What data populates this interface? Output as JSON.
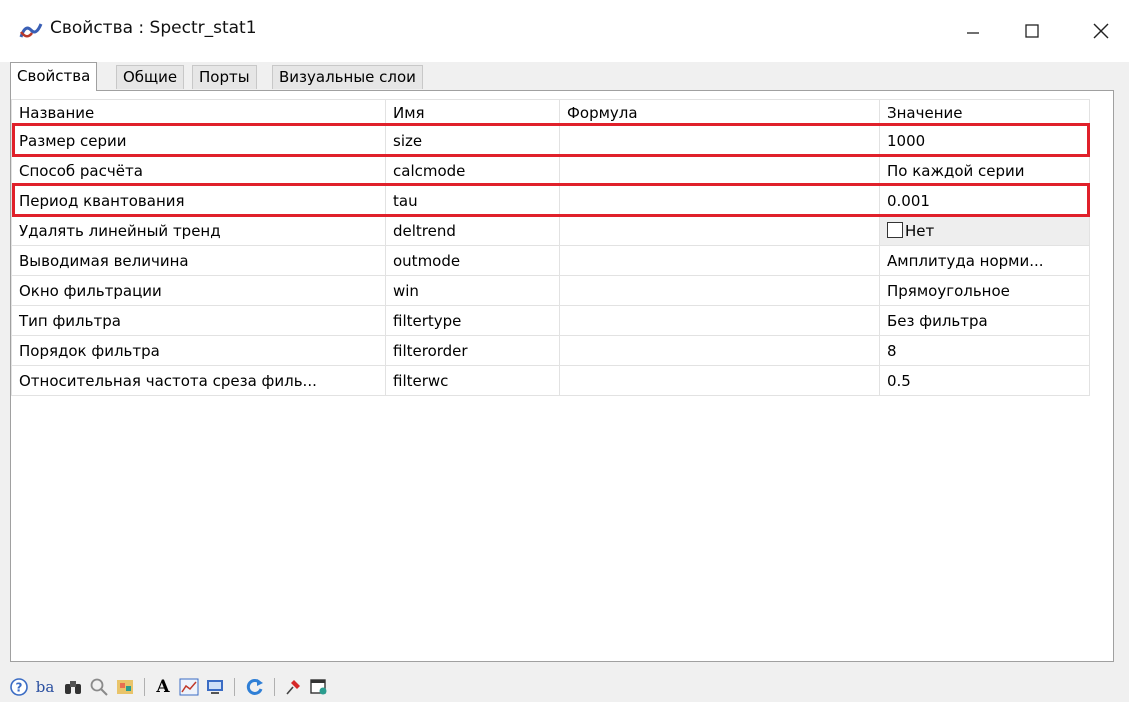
{
  "window": {
    "title": "Свойства : Spectr_stat1"
  },
  "tabs": [
    {
      "label": "Свойства",
      "active": true
    },
    {
      "label": "Общие",
      "active": false
    },
    {
      "label": "Порты",
      "active": false
    },
    {
      "label": "Визуальные слои",
      "active": false
    }
  ],
  "table": {
    "headers": [
      "Название",
      "Имя",
      "Формула",
      "Значение"
    ],
    "rows": [
      {
        "name": "Размер серии",
        "id": "size",
        "formula": "",
        "value": "1000",
        "highlighted": true
      },
      {
        "name": "Способ расчёта",
        "id": "calcmode",
        "formula": "",
        "value": "По каждой серии",
        "highlighted": false
      },
      {
        "name": "Период квантования",
        "id": "tau",
        "formula": "",
        "value": "0.001",
        "highlighted": true
      },
      {
        "name": "Удалять линейный тренд",
        "id": "deltrend",
        "formula": "",
        "value": "Нет",
        "checkbox": true,
        "checked": false,
        "highlighted": false
      },
      {
        "name": "Выводимая величина",
        "id": "outmode",
        "formula": "",
        "value": "Амплитуда норми...",
        "highlighted": false
      },
      {
        "name": "Окно фильтрации",
        "id": "win",
        "formula": "",
        "value": "Прямоугольное",
        "highlighted": false
      },
      {
        "name": "Тип фильтра",
        "id": "filtertype",
        "formula": "",
        "value": "Без фильтра",
        "highlighted": false
      },
      {
        "name": "Порядок фильтра",
        "id": "filterorder",
        "formula": "",
        "value": "8",
        "highlighted": false
      },
      {
        "name": "Относительная частота среза филь...",
        "id": "filterwc",
        "formula": "",
        "value": "0.5",
        "highlighted": false
      }
    ]
  },
  "colors": {
    "highlight": "#e0202a"
  },
  "toolbar": {
    "icons": [
      "help-icon",
      "sort-alpha-icon",
      "binoculars-icon",
      "zoom-icon",
      "palette-icon",
      "separator",
      "font-icon",
      "chart-icon",
      "monitor-icon",
      "separator",
      "refresh-icon",
      "separator",
      "pin-icon",
      "window-list-icon"
    ],
    "font_glyph": "A",
    "sort_glyph": "ba"
  }
}
